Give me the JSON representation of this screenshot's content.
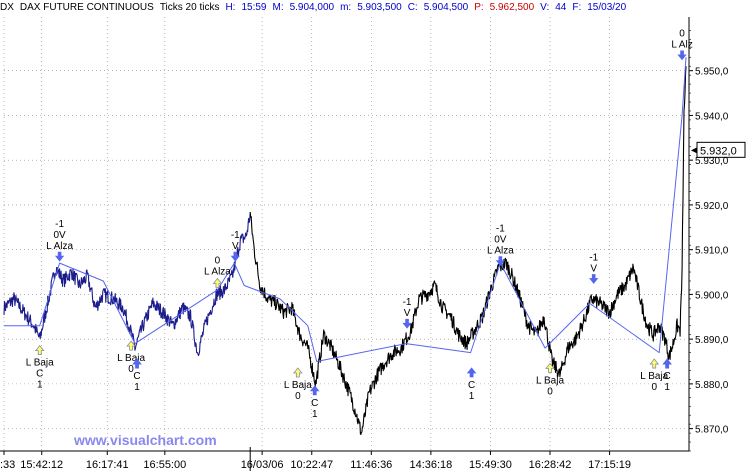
{
  "header": {
    "symbol": "DX",
    "instrument": "DAX FUTURE CONTINUOUS",
    "timeframe": "Ticks 20 ticks",
    "hour_label": "H:",
    "hour": "15:59",
    "max_label": "M:",
    "max": "5.904,000",
    "min_label": "m:",
    "min": "5.903,500",
    "close_label": "C:",
    "close": "5.904,500",
    "p_label": "P:",
    "p": "5.962,500",
    "volume_label": "V:",
    "volume": "44",
    "date_label": "F:",
    "date": "15/03/20"
  },
  "watermark": "www.visualchart.com",
  "price_box": "5.932,0",
  "chart_data": {
    "type": "line",
    "ylim": [
      5865,
      5962
    ],
    "yticks": [
      "5.870,0",
      "5.880,0",
      "5.890,0",
      "5.900,0",
      "5.910,0",
      "5.920,0",
      "5.930,0",
      "5.940,0",
      "5.950,0"
    ],
    "ytick_values": [
      5870,
      5880,
      5890,
      5900,
      5910,
      5920,
      5930,
      5940,
      5950
    ],
    "xticks": [
      ":33",
      "15:42:12",
      "16:17:41",
      "16:55:00",
      "16/03/06",
      "10:22:47",
      "11:46:36",
      "14:36:18",
      "15:49:30",
      "16:28:42",
      "17:15:19"
    ],
    "xtick_index": [
      0,
      38,
      104,
      162,
      260,
      310,
      370,
      430,
      490,
      550,
      610
    ],
    "index_range": [
      0,
      690
    ],
    "day_split_index": 248,
    "price_path": [
      [
        0,
        5897
      ],
      [
        10,
        5899
      ],
      [
        20,
        5896
      ],
      [
        30,
        5893
      ],
      [
        36,
        5890
      ],
      [
        44,
        5898
      ],
      [
        52,
        5906
      ],
      [
        60,
        5903
      ],
      [
        68,
        5905
      ],
      [
        76,
        5902
      ],
      [
        84,
        5904
      ],
      [
        92,
        5897
      ],
      [
        100,
        5900
      ],
      [
        110,
        5899
      ],
      [
        120,
        5897
      ],
      [
        126,
        5893
      ],
      [
        132,
        5888
      ],
      [
        140,
        5893
      ],
      [
        150,
        5898
      ],
      [
        160,
        5896
      ],
      [
        170,
        5893
      ],
      [
        180,
        5897
      ],
      [
        188,
        5895
      ],
      [
        195,
        5887
      ],
      [
        204,
        5894
      ],
      [
        214,
        5900
      ],
      [
        222,
        5901
      ],
      [
        230,
        5904
      ],
      [
        238,
        5912
      ],
      [
        244,
        5913
      ],
      [
        248,
        5918
      ],
      [
        252,
        5910
      ],
      [
        258,
        5902
      ],
      [
        266,
        5899
      ],
      [
        274,
        5898
      ],
      [
        282,
        5896
      ],
      [
        290,
        5897
      ],
      [
        298,
        5891
      ],
      [
        306,
        5888
      ],
      [
        314,
        5880
      ],
      [
        322,
        5891
      ],
      [
        330,
        5888
      ],
      [
        338,
        5884
      ],
      [
        348,
        5878
      ],
      [
        354,
        5874
      ],
      [
        360,
        5869
      ],
      [
        368,
        5878
      ],
      [
        376,
        5882
      ],
      [
        384,
        5885
      ],
      [
        392,
        5887
      ],
      [
        400,
        5888
      ],
      [
        410,
        5892
      ],
      [
        418,
        5899
      ],
      [
        426,
        5900
      ],
      [
        434,
        5902
      ],
      [
        442,
        5897
      ],
      [
        450,
        5895
      ],
      [
        458,
        5891
      ],
      [
        466,
        5889
      ],
      [
        474,
        5892
      ],
      [
        482,
        5895
      ],
      [
        490,
        5901
      ],
      [
        498,
        5906
      ],
      [
        506,
        5907
      ],
      [
        512,
        5904
      ],
      [
        520,
        5899
      ],
      [
        528,
        5893
      ],
      [
        536,
        5891
      ],
      [
        544,
        5895
      ],
      [
        552,
        5885
      ],
      [
        560,
        5882
      ],
      [
        568,
        5888
      ],
      [
        576,
        5890
      ],
      [
        584,
        5894
      ],
      [
        592,
        5899
      ],
      [
        600,
        5898
      ],
      [
        610,
        5896
      ],
      [
        618,
        5900
      ],
      [
        626,
        5902
      ],
      [
        634,
        5906
      ],
      [
        642,
        5898
      ],
      [
        648,
        5893
      ],
      [
        654,
        5891
      ],
      [
        660,
        5893
      ],
      [
        666,
        5890
      ],
      [
        670,
        5886
      ],
      [
        674,
        5889
      ],
      [
        678,
        5893
      ],
      [
        681,
        5892
      ],
      [
        683,
        5905
      ],
      [
        685,
        5940
      ],
      [
        687,
        5951
      ]
    ],
    "zigzag": [
      [
        0,
        5893
      ],
      [
        36,
        5893
      ],
      [
        56,
        5907
      ],
      [
        100,
        5903
      ],
      [
        132,
        5889
      ],
      [
        215,
        5901
      ],
      [
        232,
        5907
      ],
      [
        242,
        5902
      ],
      [
        278,
        5899
      ],
      [
        306,
        5893
      ],
      [
        315,
        5885
      ],
      [
        405,
        5889
      ],
      [
        470,
        5887
      ],
      [
        500,
        5907
      ],
      [
        545,
        5888
      ],
      [
        590,
        5898
      ],
      [
        660,
        5887
      ],
      [
        683,
        5940
      ],
      [
        687,
        5953
      ]
    ]
  },
  "annotations": [
    {
      "id": "a1",
      "index": 36,
      "dir": "up",
      "tip": 5889,
      "lines_below": [
        "L Baja",
        "C",
        "1"
      ]
    },
    {
      "id": "a2",
      "index": 56,
      "dir": "down",
      "tip": 5907,
      "lines_above": [
        "-1",
        "0V",
        "L Alza"
      ]
    },
    {
      "id": "a3",
      "index": 128,
      "dir": "up",
      "tip": 5890,
      "lines_below": [
        "L Baja",
        "0"
      ]
    },
    {
      "id": "a4",
      "index": 134,
      "dir": "up",
      "tip": 5886,
      "lines_below": [
        "C",
        "1"
      ]
    },
    {
      "id": "a5",
      "index": 215,
      "dir": "up",
      "tip": 5904,
      "lines_above": [
        "0",
        "L Alza"
      ]
    },
    {
      "id": "a6",
      "index": 233,
      "dir": "down",
      "tip": 5907,
      "lines_above": [
        "-1",
        "V"
      ]
    },
    {
      "id": "a7",
      "index": 296,
      "dir": "up",
      "tip": 5884,
      "lines_below": [
        "L Baja",
        "0"
      ]
    },
    {
      "id": "a8",
      "index": 313,
      "dir": "up",
      "tip": 5880,
      "lines_below": [
        "C",
        "1"
      ]
    },
    {
      "id": "a9",
      "index": 406,
      "dir": "down",
      "tip": 5892,
      "lines_above": [
        "-1",
        "V"
      ]
    },
    {
      "id": "a10",
      "index": 471,
      "dir": "up",
      "tip": 5884,
      "lines_below": [
        "C",
        "1"
      ]
    },
    {
      "id": "a11",
      "index": 500,
      "dir": "down",
      "tip": 5906,
      "lines_above": [
        "-1",
        "0V",
        "L Alza"
      ]
    },
    {
      "id": "a12",
      "index": 550,
      "dir": "up",
      "tip": 5885,
      "lines_below": [
        "L Baja",
        "0"
      ]
    },
    {
      "id": "a13",
      "index": 594,
      "dir": "down",
      "tip": 5902,
      "lines_above": [
        "-1",
        "V"
      ]
    },
    {
      "id": "a14",
      "index": 655,
      "dir": "up",
      "tip": 5886,
      "lines_below": [
        "L Baja",
        "0"
      ]
    },
    {
      "id": "a15",
      "index": 668,
      "dir": "up",
      "tip": 5886,
      "lines_below": [
        "C",
        "1"
      ]
    },
    {
      "id": "a16",
      "index": 683,
      "dir": "down",
      "tip": 5952,
      "lines_above": [
        "0",
        "L Alz"
      ]
    }
  ],
  "colors": {
    "price_day1": "#1c1c8c",
    "price_day2": "#000000",
    "zigzag": "#5566ee",
    "arrow_down": "#5566ee",
    "arrow_up_fill": "#ffff66",
    "arrow_up_stroke": "#8888aa",
    "arrow_up_blue": "#5566ee",
    "axis": "#000000",
    "watermark": "#8888ee"
  }
}
